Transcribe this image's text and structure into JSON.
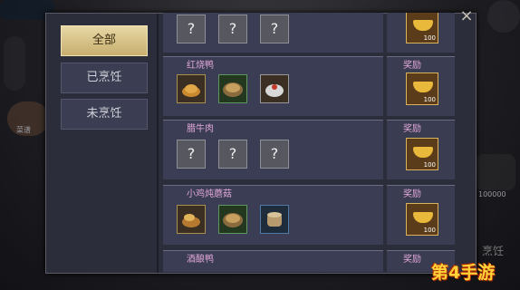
{
  "tabs": [
    "全部",
    "已烹饪",
    "未烹饪"
  ],
  "close_icon": "×",
  "reward_label": "奖励",
  "gold_count": "100",
  "cards": [
    {
      "title": "",
      "slots": [
        "?",
        "?",
        "?"
      ],
      "slot_icons": []
    },
    {
      "title": "红烧鸭",
      "slot_icons": [
        "roast-duck-icon",
        "stew-pot-icon",
        "rice-bowl-icon"
      ]
    },
    {
      "title": "腊牛肉",
      "slots": [
        "?",
        "?",
        "?"
      ]
    },
    {
      "title": "小鸡炖蘑菇",
      "slot_icons": [
        "chicken-mushroom-icon",
        "stew-pot-icon",
        "soup-jar-icon"
      ]
    },
    {
      "title": "酒酿鸭"
    }
  ],
  "bg": {
    "left_label": "菜谱",
    "right_number": "100000",
    "right_cn": "烹饪"
  },
  "watermark": "第4手游"
}
